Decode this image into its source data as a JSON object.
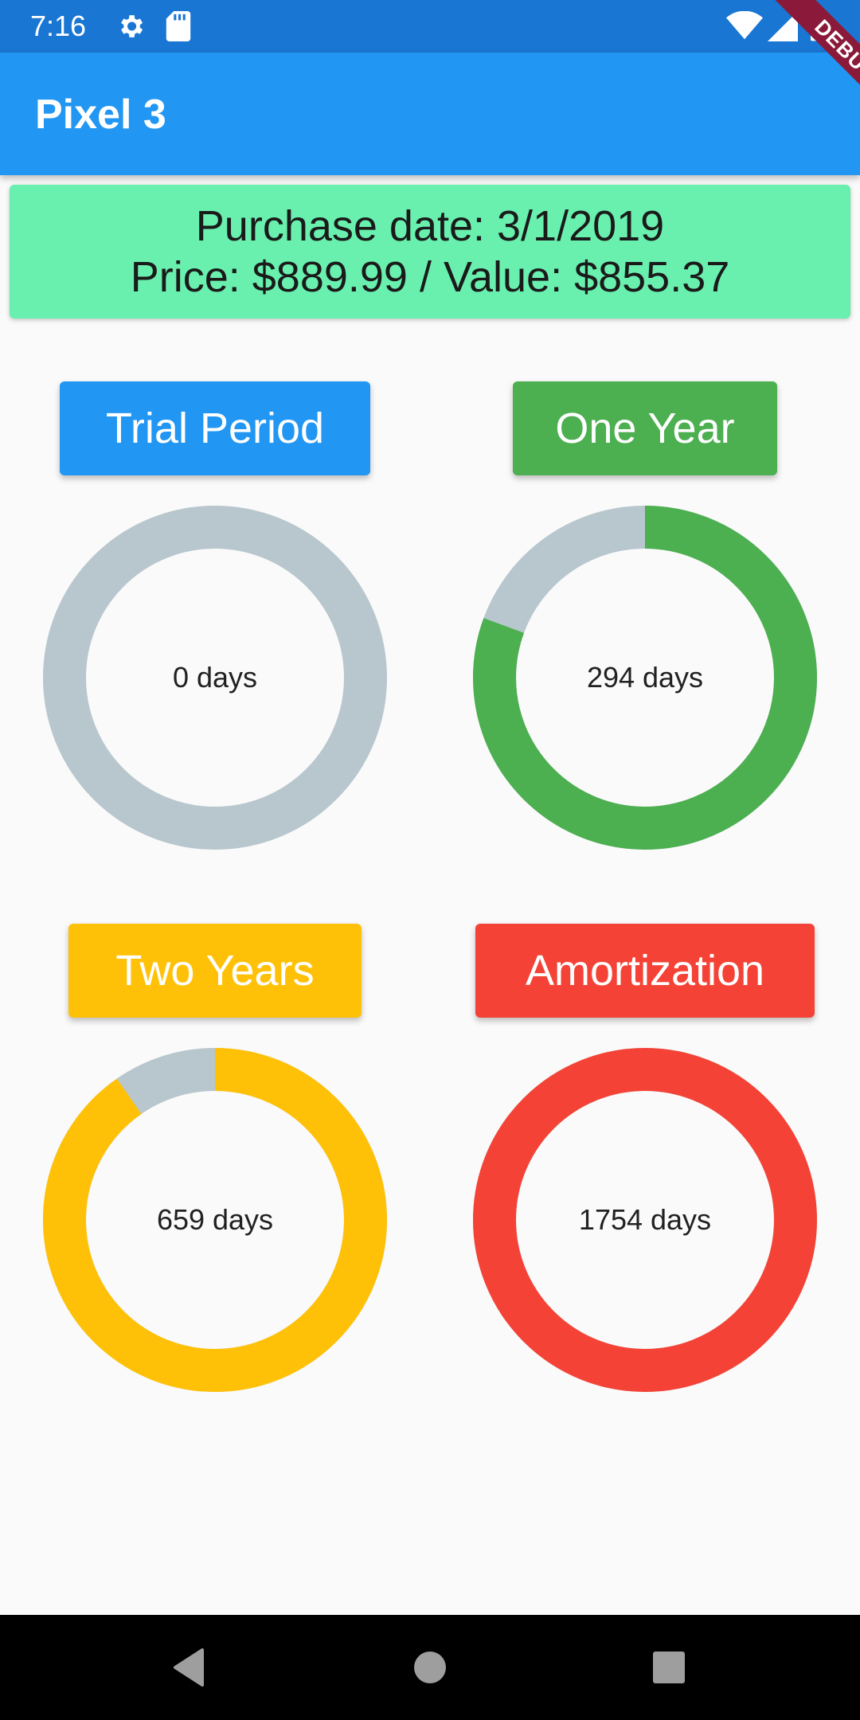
{
  "status_bar": {
    "time": "7:16",
    "icons": [
      "gear-icon",
      "sd-card-icon",
      "wifi-icon",
      "signal-icon",
      "battery-icon"
    ]
  },
  "app_bar": {
    "title": "Pixel 3",
    "debug_label": "DEBUG"
  },
  "info": {
    "purchase_line": "Purchase date: 3/1/2019",
    "price_line": "Price: $889.99 / Value: $855.37"
  },
  "tiles": [
    {
      "label": "Trial Period",
      "value_text": "0 days",
      "progress": 0.0,
      "color": "#2196f3",
      "ring_color": "#2196f3"
    },
    {
      "label": "One Year",
      "value_text": "294 days",
      "progress": 0.806,
      "color": "#4caf50",
      "ring_color": "#4caf50"
    },
    {
      "label": "Two Years",
      "value_text": "659 days",
      "progress": 0.903,
      "color": "#ffc107",
      "ring_color": "#ffc107"
    },
    {
      "label": "Amortization",
      "value_text": "1754 days",
      "progress": 1.0,
      "color": "#f44336",
      "ring_color": "#f44336"
    }
  ],
  "ring_track_color": "#b8c7cd",
  "nav_bar": {
    "icons": [
      "back-icon",
      "home-icon",
      "recents-icon"
    ]
  }
}
